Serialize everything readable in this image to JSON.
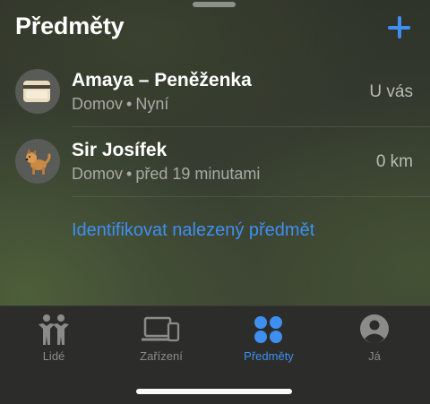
{
  "header": {
    "title": "Předměty",
    "add_icon": "plus-icon"
  },
  "items": [
    {
      "name": "Amaya – Peněženka",
      "location": "Domov",
      "time": "Nyní",
      "distance": "U vás",
      "icon": "wallet-card-icon"
    },
    {
      "name": "Sir Josífek",
      "location": "Domov",
      "time": "před 19 minutami",
      "distance": "0 km",
      "icon": "dog-icon"
    }
  ],
  "identify_link": "Identifikovat nalezený předmět",
  "tabs": [
    {
      "label": "Lidé",
      "icon": "people-icon",
      "active": false
    },
    {
      "label": "Zařízení",
      "icon": "devices-icon",
      "active": false
    },
    {
      "label": "Předměty",
      "icon": "items-grid-icon",
      "active": true
    },
    {
      "label": "Já",
      "icon": "person-circle-icon",
      "active": false
    }
  ],
  "colors": {
    "accent": "#3f8ff0",
    "background": "#363c30",
    "tabbar": "#2c2d2a"
  }
}
